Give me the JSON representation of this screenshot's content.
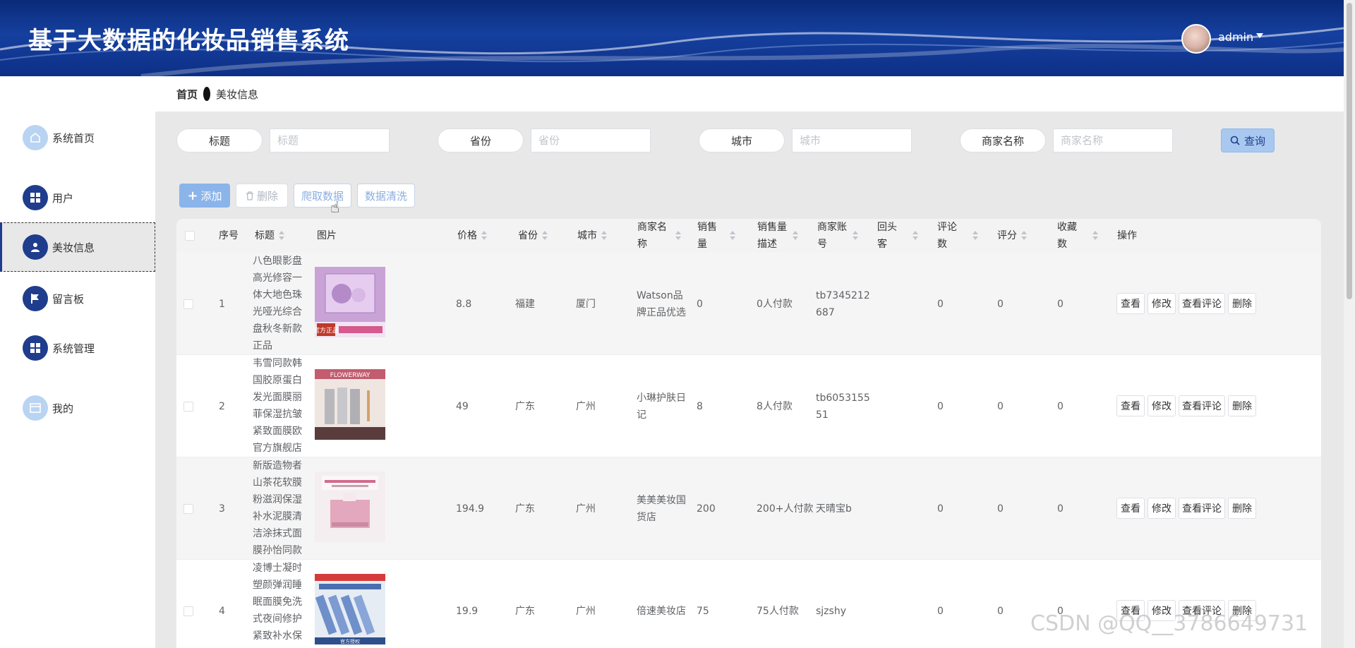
{
  "header": {
    "title": "基于大数据的化妆品销售系统",
    "user": "admin"
  },
  "sidebar": {
    "items": [
      {
        "label": "系统首页",
        "icon": "home-icon"
      },
      {
        "label": "用户",
        "icon": "grid-icon"
      },
      {
        "label": "美妆信息",
        "icon": "user-icon"
      },
      {
        "label": "留言板",
        "icon": "flag-icon"
      },
      {
        "label": "系统管理",
        "icon": "grid-icon"
      },
      {
        "label": "我的",
        "icon": "card-icon"
      }
    ]
  },
  "breadcrumb": {
    "home": "首页",
    "current": "美妆信息"
  },
  "search": {
    "title_label": "标题",
    "title_placeholder": "标题",
    "province_label": "省份",
    "province_placeholder": "省份",
    "city_label": "城市",
    "city_placeholder": "城市",
    "merchant_label": "商家名称",
    "merchant_placeholder": "商家名称",
    "query": "查询"
  },
  "actions": {
    "add": "添加",
    "delete": "删除",
    "crawl": "爬取数据",
    "clean": "数据清洗"
  },
  "table": {
    "headers": {
      "index": "序号",
      "title": "标题",
      "image": "图片",
      "price": "价格",
      "province": "省份",
      "city": "城市",
      "merchant_l1": "商家名",
      "merchant_l2": "称",
      "sales_l1": "销售",
      "sales_l2": "量",
      "salesdesc_l1": "销售量",
      "salesdesc_l2": "描述",
      "account_l1": "商家账",
      "account_l2": "号",
      "repeat_l1": "回头",
      "repeat_l2": "客",
      "comments_l1": "评论",
      "comments_l2": "数",
      "rating": "评分",
      "favorites_l1": "收藏",
      "favorites_l2": "数",
      "ops": "操作"
    },
    "op_labels": {
      "view": "查看",
      "edit": "修改",
      "comments": "查看评论",
      "delete": "删除"
    },
    "rows": [
      {
        "index": "1",
        "title_lines": [
          "八色眼影盘",
          "高光修容一",
          "体大地色珠",
          "光哑光综合",
          "盘秋冬新款",
          "正品"
        ],
        "price": "8.8",
        "province": "福建",
        "city": "厦门",
        "merchant_lines": [
          "Watson品",
          "牌正品优选"
        ],
        "sales": "0",
        "sales_desc": "0人付款",
        "account_lines": [
          "tb7345212",
          "687"
        ],
        "repeat": "",
        "comments": "0",
        "rating": "0",
        "favorites": "0",
        "img_badge": "官方正品"
      },
      {
        "index": "2",
        "title_lines": [
          "韦雪同款韩",
          "国胶原蛋白",
          "发光面膜丽",
          "菲保湿抗皱",
          "紧致面膜欧",
          "官方旗舰店"
        ],
        "price": "49",
        "province": "广东",
        "city": "广州",
        "merchant_lines": [
          "小琳护肤日",
          "记"
        ],
        "sales": "8",
        "sales_desc": "8人付款",
        "account_lines": [
          "tb6053155",
          "51"
        ],
        "repeat": "",
        "comments": "0",
        "rating": "0",
        "favorites": "0",
        "img_badge": "FLOWERWAY"
      },
      {
        "index": "3",
        "title_lines": [
          "新版造物者",
          "山茶花软膜",
          "粉滋润保湿",
          "补水泥膜清",
          "洁涂抹式面",
          "膜孙怡同款"
        ],
        "price": "194.9",
        "province": "广东",
        "city": "广州",
        "merchant_lines": [
          "美美美妆国",
          "货店"
        ],
        "sales": "200",
        "sales_desc": "200+人付款",
        "account_lines": [
          "天晴宝b"
        ],
        "repeat": "",
        "comments": "0",
        "rating": "0",
        "favorites": "0",
        "img_badge": ""
      },
      {
        "index": "4",
        "title_lines": [
          "凌博士凝时",
          "塑颜弹润睡",
          "眠面膜免洗",
          "式夜间修护",
          "紧致补水保"
        ],
        "price": "19.9",
        "province": "广东",
        "city": "广州",
        "merchant_lines": [
          "倍速美妆店"
        ],
        "sales": "75",
        "sales_desc": "75人付款",
        "account_lines": [
          "sjzshy"
        ],
        "repeat": "",
        "comments": "0",
        "rating": "0",
        "favorites": "0",
        "img_badge": "官方授权"
      }
    ]
  },
  "watermark": "CSDN @QQ__3786649731",
  "colors": {
    "header": "#15409f",
    "accent": "#1f3d8c",
    "light_button": "#8ab4ea"
  }
}
